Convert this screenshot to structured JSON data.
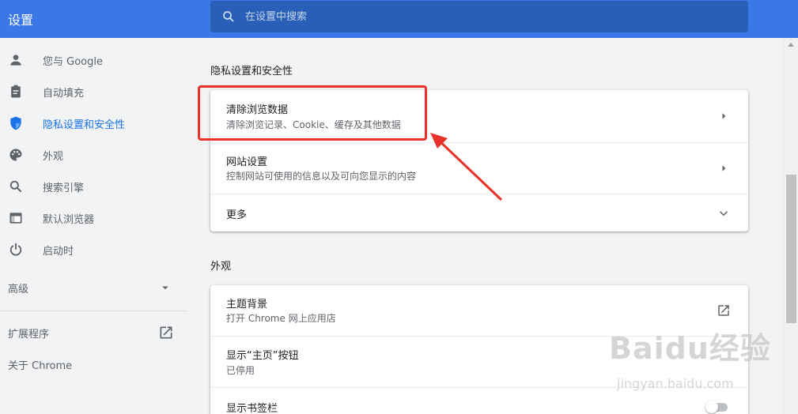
{
  "header": {
    "title": "设置",
    "search_placeholder": "在设置中搜索"
  },
  "sidebar": {
    "items": [
      {
        "label": "您与 Google",
        "icon": "person-icon"
      },
      {
        "label": "自动填充",
        "icon": "clipboard-icon"
      },
      {
        "label": "隐私设置和安全性",
        "icon": "shield-icon",
        "active": true
      },
      {
        "label": "外观",
        "icon": "palette-icon"
      },
      {
        "label": "搜索引擎",
        "icon": "search-icon"
      },
      {
        "label": "默认浏览器",
        "icon": "browser-window-icon"
      },
      {
        "label": "启动时",
        "icon": "power-icon"
      }
    ],
    "advanced_label": "高级",
    "extensions_label": "扩展程序",
    "about_label": "关于 Chrome"
  },
  "privacy": {
    "section_title": "隐私设置和安全性",
    "rows": [
      {
        "title": "清除浏览数据",
        "subtitle": "清除浏览记录、Cookie、缓存及其他数据"
      },
      {
        "title": "网站设置",
        "subtitle": "控制网站可使用的信息以及可向您显示的内容"
      },
      {
        "title": "更多"
      }
    ]
  },
  "appearance": {
    "section_title": "外观",
    "rows": [
      {
        "title": "主题背景",
        "subtitle": "打开 Chrome 网上应用店"
      },
      {
        "title": "显示“主页”按钮",
        "subtitle": "已停用"
      },
      {
        "title": "显示书签栏"
      }
    ]
  },
  "colors": {
    "header": "#3b78e7",
    "accent": "#1a73e8",
    "annotation": "#e8322a"
  },
  "watermark": {
    "logo": "Baidu经验",
    "url": "jingyan.baidu.com"
  }
}
